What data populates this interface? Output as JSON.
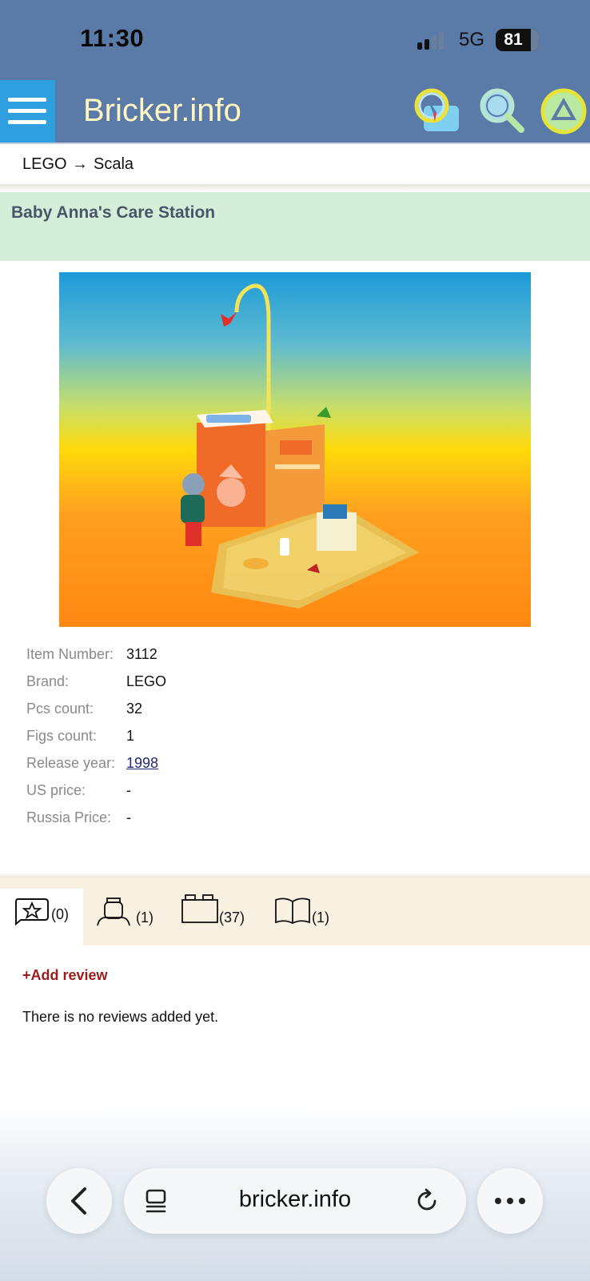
{
  "status_bar": {
    "time": "11:30",
    "network": "5G",
    "battery": "81"
  },
  "header": {
    "brand": "Bricker.info",
    "icons": [
      "menu-icon",
      "compass-icon",
      "search-icon",
      "logo-triangle-icon"
    ]
  },
  "breadcrumb": {
    "root": "LEGO",
    "separator": "→",
    "current": "Scala"
  },
  "product": {
    "title": "Baby Anna's Care Station",
    "specs": [
      {
        "label": "Item Number:",
        "value": "3112"
      },
      {
        "label": "Brand:",
        "value": "LEGO"
      },
      {
        "label": "Pcs count:",
        "value": "32"
      },
      {
        "label": "Figs count:",
        "value": "1"
      },
      {
        "label": "Release year:",
        "value": "1998"
      },
      {
        "label": "US price:",
        "value": "-"
      },
      {
        "label": "Russia Price:",
        "value": "-"
      }
    ]
  },
  "tabs": [
    {
      "icon": "star-review-icon",
      "count": "(0)",
      "active": true
    },
    {
      "icon": "minifigure-icon",
      "count": "(1)",
      "active": false
    },
    {
      "icon": "brick-icon",
      "count": "(37)",
      "active": false
    },
    {
      "icon": "instructions-book-icon",
      "count": "(1)",
      "active": false
    }
  ],
  "reviews": {
    "add_label": "+Add review",
    "empty_text": "There is no reviews added yet."
  },
  "browser": {
    "url": "bricker.info",
    "icons": [
      "back-icon",
      "tabs-icon",
      "reload-icon",
      "more-icon"
    ]
  },
  "colors": {
    "header_bg": "#5a7aa8",
    "title_band_bg": "#d5eed9",
    "tabs_bg": "#f8f0e1",
    "add_review": "#9b1c1c",
    "brand_text": "#fff6c2"
  }
}
